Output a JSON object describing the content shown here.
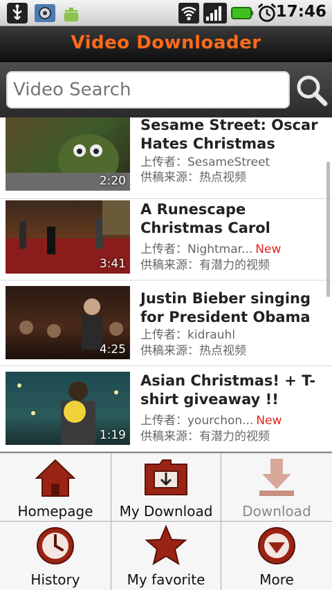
{
  "status_bar": {
    "time": "17:46",
    "icons": [
      "usb-icon",
      "settings-icon",
      "android-icon",
      "wifi-icon",
      "signal-icon",
      "battery-icon",
      "alarm-icon"
    ]
  },
  "app": {
    "title": "Video Downloader",
    "accent_color": "#ff6a1a"
  },
  "search": {
    "placeholder": "Video Search",
    "button_icon": "search-icon"
  },
  "videos": [
    {
      "title": "Sesame Street: Oscar Hates Christmas",
      "duration": "2:20",
      "uploader": "上传者：SesameStreet",
      "source": "供稿来源：热点视频",
      "new": ""
    },
    {
      "title": "A Runescape Christmas Carol",
      "duration": "3:41",
      "uploader": "上传者：Nightmar...",
      "source": "供稿来源：有潜力的视频",
      "new": "New"
    },
    {
      "title": "Justin Bieber singing for President Obama",
      "duration": "4:25",
      "uploader": "上传者：kidrauhl",
      "source": "供稿来源：热点视频",
      "new": ""
    },
    {
      "title": "Asian Christmas! + T-shirt giveaway !!",
      "duration": "1:19",
      "uploader": "上传者：yourchon...",
      "source": "供稿来源：有潜力的视频",
      "new": "New"
    }
  ],
  "menu": {
    "items": [
      {
        "label": "Homepage",
        "icon": "home-icon",
        "enabled": true
      },
      {
        "label": "My Download",
        "icon": "folder-download-icon",
        "enabled": true
      },
      {
        "label": "Download",
        "icon": "download-icon",
        "enabled": false
      },
      {
        "label": "History",
        "icon": "clock-icon",
        "enabled": true
      },
      {
        "label": "My favorite",
        "icon": "star-icon",
        "enabled": true
      },
      {
        "label": "More",
        "icon": "more-icon",
        "enabled": true
      }
    ]
  }
}
